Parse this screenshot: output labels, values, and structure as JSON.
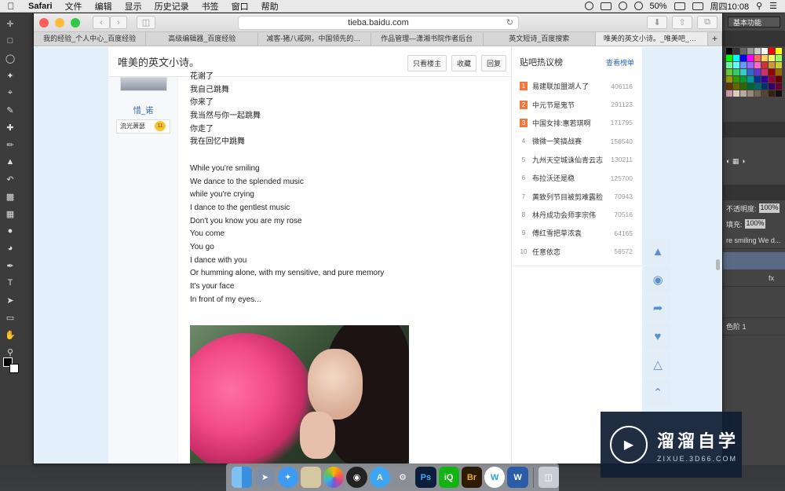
{
  "menubar": {
    "apple": "",
    "items": [
      "Safari",
      "文件",
      "编辑",
      "显示",
      "历史记录",
      "书签",
      "窗口",
      "帮助"
    ],
    "battery": "50%",
    "clock": "周四10:08"
  },
  "browser": {
    "url": "tieba.baidu.com",
    "tabs": [
      "我的经验_个人中心_百度经验",
      "高级编辑器_百度经验",
      "减客-猪八戒网，中国领先的服...",
      "作品管理—潇湘书院作者后台",
      "英文短诗_百度搜索",
      "唯美的英文小诗。_唯美吧_百..."
    ],
    "new_tab": "+"
  },
  "thread": {
    "title": "唯美的英文小诗。",
    "buttons": [
      "只看楼主",
      "收藏",
      "回复"
    ],
    "author": {
      "name": "惜_诺",
      "badge": "流光萧瑟",
      "level": "11"
    },
    "lines": [
      "花谢了",
      "我自己跳舞",
      "你来了",
      "我当然与你一起跳舞",
      "你走了",
      "我在回忆中跳舞",
      "",
      "While you're smiling",
      "We dance to the splended music",
      "while you're crying",
      "I dance to the gentlest music",
      "Don't you know you are my rose",
      "You come",
      "You go",
      "I dance with you",
      "Or humming alone, with my sensitive, and pure memory",
      "It's your face",
      "In front of my eyes..."
    ]
  },
  "sidebar": {
    "title": "贴吧热议榜",
    "more": "查看榜单",
    "items": [
      {
        "rank": "1",
        "label": "易建联加盟湖人了",
        "count": "406116"
      },
      {
        "rank": "2",
        "label": "中元节是鬼节",
        "count": "291123"
      },
      {
        "rank": "3",
        "label": "中国女排:惠若琪啊",
        "count": "171795"
      },
      {
        "rank": "4",
        "label": "微微一笑搞战赛",
        "count": "156540"
      },
      {
        "rank": "5",
        "label": "九州天空城诛仙青云志",
        "count": "130211"
      },
      {
        "rank": "6",
        "label": "布拉沃还是稳",
        "count": "125700"
      },
      {
        "rank": "7",
        "label": "黄致列节目被剪难露脸",
        "count": "70943"
      },
      {
        "rank": "8",
        "label": "林丹成功会师李宗伟",
        "count": "70516"
      },
      {
        "rank": "9",
        "label": "傅红雪把草浓袁",
        "count": "64165"
      },
      {
        "rank": "10",
        "label": "任意依恋",
        "count": "56572"
      }
    ]
  },
  "photoshop": {
    "workspace": "基本功能",
    "opacity_label": "不透明度:",
    "opacity_value": "100%",
    "fill_label": "填充:",
    "fill_value": "100%",
    "layer_text": "re smiling We d...",
    "fx": "fx",
    "layer2": "色阶 1"
  },
  "watermark": {
    "title": "溜溜自学",
    "url": "ZIXUE.3D66.COM"
  },
  "dock": [
    "Finder",
    "Launchpad",
    "Safari",
    "Preview",
    "Photos",
    "QQ",
    "App Store",
    "System Preferences",
    "Ps",
    "iQIYI",
    "Br",
    "W",
    "Word",
    "Trash"
  ],
  "colors": {
    "accent_blue": "#2d64b3",
    "rank_orange": "#f2773b",
    "page_bg": "#e3effa"
  }
}
